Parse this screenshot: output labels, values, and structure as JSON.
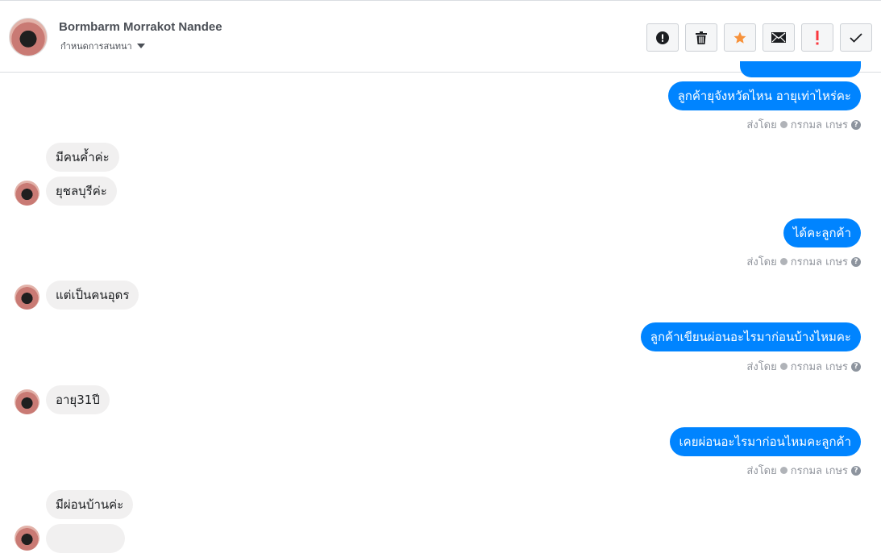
{
  "header": {
    "contact_name": "Bormbarm Morrakot Nandee",
    "assign_label": "กำหนดการสนทนา",
    "actions": [
      {
        "name": "report-spam",
        "icon": "alert-circle-icon"
      },
      {
        "name": "delete",
        "icon": "trash-icon"
      },
      {
        "name": "star",
        "icon": "star-icon",
        "color": "#f7923b"
      },
      {
        "name": "mark-unread",
        "icon": "envelope-icon"
      },
      {
        "name": "follow-up",
        "icon": "exclamation-icon",
        "color": "#fa383e"
      },
      {
        "name": "mark-done",
        "icon": "check-icon"
      }
    ]
  },
  "colors": {
    "outgoing": "#0084ff",
    "incoming": "#f1f0f0",
    "meta": "#90949c"
  },
  "messages": [
    {
      "dir": "out",
      "text": "ลูกค้ายุจังหวัดไหน อายุเท่าไหร่คะ"
    },
    {
      "dir": "meta",
      "sent_by_label": "ส่งโดย",
      "sender": "กรกมล เกษร",
      "help": "?"
    },
    {
      "dir": "in",
      "text": "มีคนค้ำค่ะ"
    },
    {
      "dir": "in",
      "text": "ยุชลบุรีค่ะ"
    },
    {
      "dir": "out",
      "text": "ได้คะลูกค้า"
    },
    {
      "dir": "meta",
      "sent_by_label": "ส่งโดย",
      "sender": "กรกมล เกษร",
      "help": "?"
    },
    {
      "dir": "in",
      "text": "แต่เป็นคนอุดร"
    },
    {
      "dir": "out",
      "text": "ลูกค้าเขียนผ่อนอะไรมาก่อนบ้างไหมคะ"
    },
    {
      "dir": "meta",
      "sent_by_label": "ส่งโดย",
      "sender": "กรกมล เกษร",
      "help": "?"
    },
    {
      "dir": "in",
      "text": "อายุ31ปี"
    },
    {
      "dir": "out",
      "text": "เคยผ่อนอะไรมาก่อนไหมคะลูกค้า"
    },
    {
      "dir": "meta",
      "sent_by_label": "ส่งโดย",
      "sender": "กรกมล เกษร",
      "help": "?"
    },
    {
      "dir": "in",
      "text": "มีผ่อนบ้านค่ะ"
    }
  ]
}
